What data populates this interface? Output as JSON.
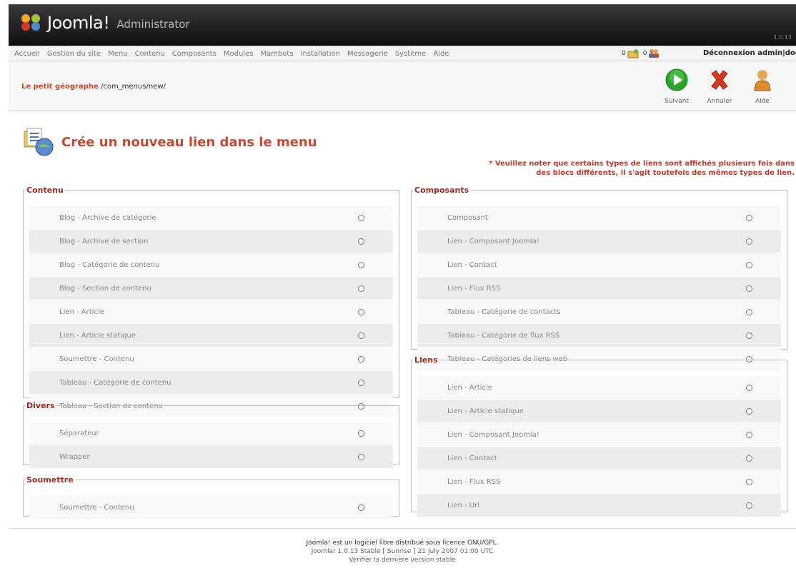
{
  "header": {
    "brand": "Joomla!",
    "subtitle": "Administrator",
    "version_label": "1.0.13"
  },
  "menu": {
    "items": [
      "Accueil",
      "Gestion du site",
      "Menu",
      "Contenu",
      "Composants",
      "Modules",
      "Mambots",
      "Installation",
      "Messagerie",
      "Système",
      "Aide"
    ],
    "messages_count": "0",
    "users_count": "0",
    "logout": "Déconnexion admin|doc"
  },
  "toolbar": {
    "path_title": "Le petit géographe",
    "path_rest": "/com_menus/new/",
    "buttons": [
      {
        "label": "Suivant",
        "color": "#2aa52a"
      },
      {
        "label": "Annuler",
        "color": "#d9371b"
      },
      {
        "label": "Aide",
        "color": "#e08a2b"
      }
    ]
  },
  "page": {
    "title": "Crée un nouveau lien dans le menu",
    "note": "* Veuillez noter que certains types de liens sont affichés plusieurs fois dans des blocs différents, il s'agit toutefois des mêmes types de lien."
  },
  "sections": {
    "contenu": {
      "legend": "Contenu",
      "items": [
        "Blog - Archive de catégorie",
        "Blog - Archive de section",
        "Blog - Catégorie de contenu",
        "Blog - Section de contenu",
        "Lien - Article",
        "Lien - Article statique",
        "Soumettre - Contenu",
        "Tableau - Catégorie de contenu",
        "Tableau - Section de contenu"
      ]
    },
    "divers": {
      "legend": "Divers",
      "items": [
        "Séparateur",
        "Wrapper"
      ]
    },
    "soumettre": {
      "legend": "Soumettre",
      "items": [
        "Soumettre - Contenu"
      ]
    },
    "composants": {
      "legend": "Composants",
      "items": [
        "Composant",
        "Lien - Composant Joomla!",
        "Lien - Contact",
        "Lien - Flux RSS",
        "Tableau - Catégorie de contacts",
        "Tableau - Catégorie de flux RSS",
        "Tableau - Catégories de liens web"
      ]
    },
    "liens": {
      "legend": "Liens",
      "items": [
        "Lien - Article",
        "Lien - Article statique",
        "Lien - Composant Joomla!",
        "Lien - Contact",
        "Lien - Flux RSS",
        "Lien - Url"
      ]
    }
  },
  "footer": {
    "line1": "Joomla! est un logiciel libre distribué sous licence GNU/GPL.",
    "line2": "Joomla! 1.0.13 Stable [ Sunrise ] 21 July 2007 01:00 UTC",
    "line3": "Vérifier la dernière version stable"
  }
}
